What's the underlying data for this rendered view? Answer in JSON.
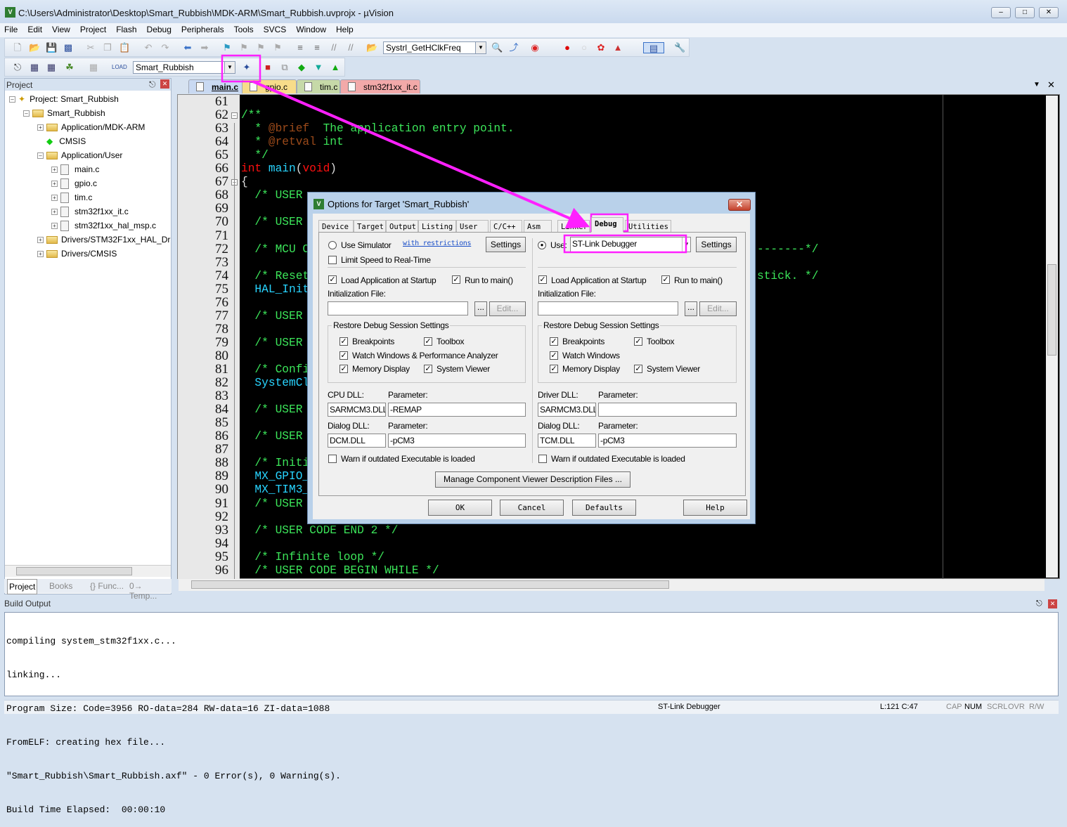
{
  "window": {
    "title": "C:\\Users\\Administrator\\Desktop\\Smart_Rubbish\\MDK-ARM\\Smart_Rubbish.uvprojx - µVision"
  },
  "menu": [
    "File",
    "Edit",
    "View",
    "Project",
    "Flash",
    "Debug",
    "Peripherals",
    "Tools",
    "SVCS",
    "Window",
    "Help"
  ],
  "toolbar": {
    "find_combo": "Systrl_GetHClkFreq",
    "target_combo": "Smart_Rubbish"
  },
  "project_panel": {
    "title": "Project",
    "root": "Project: Smart_Rubbish",
    "target": "Smart_Rubbish",
    "groups": [
      "Application/MDK-ARM",
      "CMSIS",
      "Application/User",
      "Drivers/STM32F1xx_HAL_Driver",
      "Drivers/CMSIS"
    ],
    "user_files": [
      "main.c",
      "gpio.c",
      "tim.c",
      "stm32f1xx_it.c",
      "stm32f1xx_hal_msp.c"
    ],
    "bottom_tabs": [
      "Project",
      "Books",
      "{} Func...",
      "0→ Temp..."
    ]
  },
  "editor_tabs": [
    {
      "label": "main.c",
      "color": "#c9d9f2",
      "active": true
    },
    {
      "label": "gpio.c",
      "color": "#f7dc8a"
    },
    {
      "label": "tim.c",
      "color": "#c6d9a8"
    },
    {
      "label": "stm32f1xx_it.c",
      "color": "#f2a9a9"
    }
  ],
  "code": {
    "colors": {
      "comment": "#3ce65a",
      "keyword": "#ff1010",
      "function": "#28d4ff",
      "doctag": "#9b4a1a"
    },
    "lines": [
      {
        "n": "61",
        "s": []
      },
      {
        "n": "62",
        "s": [
          [
            "/**",
            "cm"
          ]
        ]
      },
      {
        "n": "63",
        "s": [
          [
            "  * ",
            "cm"
          ],
          [
            "@brief",
            "dt"
          ],
          [
            "  The application entry point.",
            "cm"
          ]
        ]
      },
      {
        "n": "64",
        "s": [
          [
            "  * ",
            "cm"
          ],
          [
            "@retval",
            "dt"
          ],
          [
            " int",
            "cm"
          ]
        ]
      },
      {
        "n": "65",
        "s": [
          [
            "  */",
            "cm"
          ]
        ]
      },
      {
        "n": "66",
        "s": [
          [
            "int ",
            "kw"
          ],
          [
            "main",
            "fn"
          ],
          [
            "(",
            "pl"
          ],
          [
            "void",
            "kw"
          ],
          [
            ")",
            "pl"
          ]
        ]
      },
      {
        "n": "67",
        "s": [
          [
            "{",
            "pl"
          ]
        ]
      },
      {
        "n": "68",
        "s": [
          [
            "  /* USER",
            "cm"
          ]
        ]
      },
      {
        "n": "69",
        "s": []
      },
      {
        "n": "70",
        "s": [
          [
            "  /* USER",
            "cm"
          ]
        ]
      },
      {
        "n": "71",
        "s": []
      },
      {
        "n": "72",
        "s": [
          [
            "  /* MCU C",
            "cm"
          ]
        ],
        "r": "-------*/"
      },
      {
        "n": "73",
        "s": []
      },
      {
        "n": "74",
        "s": [
          [
            "  /* Reset",
            "cm"
          ]
        ],
        "r": "stick. */"
      },
      {
        "n": "75",
        "s": [
          [
            "  HAL_Init",
            "fn"
          ]
        ]
      },
      {
        "n": "76",
        "s": []
      },
      {
        "n": "77",
        "s": [
          [
            "  /* USER",
            "cm"
          ]
        ]
      },
      {
        "n": "78",
        "s": []
      },
      {
        "n": "79",
        "s": [
          [
            "  /* USER",
            "cm"
          ]
        ]
      },
      {
        "n": "80",
        "s": []
      },
      {
        "n": "81",
        "s": [
          [
            "  /* Confi",
            "cm"
          ]
        ]
      },
      {
        "n": "82",
        "s": [
          [
            "  SystemCl",
            "fn"
          ]
        ]
      },
      {
        "n": "83",
        "s": []
      },
      {
        "n": "84",
        "s": [
          [
            "  /* USER",
            "cm"
          ]
        ]
      },
      {
        "n": "85",
        "s": []
      },
      {
        "n": "86",
        "s": [
          [
            "  /* USER",
            "cm"
          ]
        ]
      },
      {
        "n": "87",
        "s": []
      },
      {
        "n": "88",
        "s": [
          [
            "  /* Initi",
            "cm"
          ]
        ]
      },
      {
        "n": "89",
        "s": [
          [
            "  MX_GPIO_",
            "fn"
          ]
        ]
      },
      {
        "n": "90",
        "s": [
          [
            "  MX_TIM3_",
            "fn"
          ]
        ]
      },
      {
        "n": "91",
        "s": [
          [
            "  /* USER",
            "cm"
          ]
        ]
      },
      {
        "n": "92",
        "s": []
      },
      {
        "n": "93",
        "s": [
          [
            "  /* USER CODE END 2 */",
            "cm"
          ]
        ]
      },
      {
        "n": "94",
        "s": []
      },
      {
        "n": "95",
        "s": [
          [
            "  /* Infinite loop */",
            "cm"
          ]
        ]
      },
      {
        "n": "96",
        "s": [
          [
            "  /* USER CODE BEGIN WHILE */",
            "cm"
          ]
        ]
      }
    ]
  },
  "dialog": {
    "title": "Options for Target 'Smart_Rubbish'",
    "tabs": [
      "Device",
      "Target",
      "Output",
      "Listing",
      "User",
      "C/C++",
      "Asm",
      "Linker",
      "Debug",
      "Utilities"
    ],
    "active_tab": "Debug",
    "left": {
      "use_simulator": "Use Simulator",
      "restrictions_link": "with restrictions",
      "settings": "Settings",
      "limit_speed": "Limit Speed to Real-Time",
      "load_app": "Load Application at Startup",
      "run_main": "Run to main()",
      "init_file_label": "Initialization File:",
      "browse": "...",
      "edit": "Edit...",
      "restore_title": "Restore Debug Session Settings",
      "breakpoints": "Breakpoints",
      "toolbox": "Toolbox",
      "watch": "Watch Windows & Performance Analyzer",
      "memory": "Memory Display",
      "sysviewer": "System Viewer",
      "dll1_label": "CPU DLL:",
      "param_label": "Parameter:",
      "dll1": "SARMCM3.DLL",
      "dll1_param": "-REMAP",
      "dll2_label": "Dialog DLL:",
      "dll2": "DCM.DLL",
      "dll2_param": "-pCM3",
      "warn": "Warn if outdated Executable is loaded"
    },
    "right": {
      "use": "Use:",
      "debugger": "ST-Link Debugger",
      "settings": "Settings",
      "load_app": "Load Application at Startup",
      "run_main": "Run to main()",
      "init_file_label": "Initialization File:",
      "browse": "...",
      "edit": "Edit...",
      "restore_title": "Restore Debug Session Settings",
      "breakpoints": "Breakpoints",
      "toolbox": "Toolbox",
      "watch": "Watch Windows",
      "memory": "Memory Display",
      "sysviewer": "System Viewer",
      "dll1_label": "Driver DLL:",
      "param_label": "Parameter:",
      "dll1": "SARMCM3.DLL",
      "dll1_param": "",
      "dll2_label": "Dialog DLL:",
      "dll2": "TCM.DLL",
      "dll2_param": "-pCM3",
      "warn": "Warn if outdated Executable is loaded"
    },
    "manage": "Manage Component Viewer Description Files ...",
    "buttons": {
      "ok": "OK",
      "cancel": "Cancel",
      "defaults": "Defaults",
      "help": "Help"
    }
  },
  "build_output": {
    "title": "Build Output",
    "lines": [
      "compiling system_stm32f1xx.c...",
      "linking...",
      "Program Size: Code=3956 RO-data=284 RW-data=16 ZI-data=1088",
      "FromELF: creating hex file...",
      "\"Smart_Rubbish\\Smart_Rubbish.axf\" - 0 Error(s), 0 Warning(s).",
      "Build Time Elapsed:  00:00:10"
    ]
  },
  "status": {
    "debugger": "ST-Link Debugger",
    "position": "L:121 C:47",
    "cap": "CAP",
    "num": "NUM",
    "scrl": "SCRL",
    "ovr": "OVR",
    "rw": "R/W"
  },
  "annotation_color": "#ff20ff"
}
